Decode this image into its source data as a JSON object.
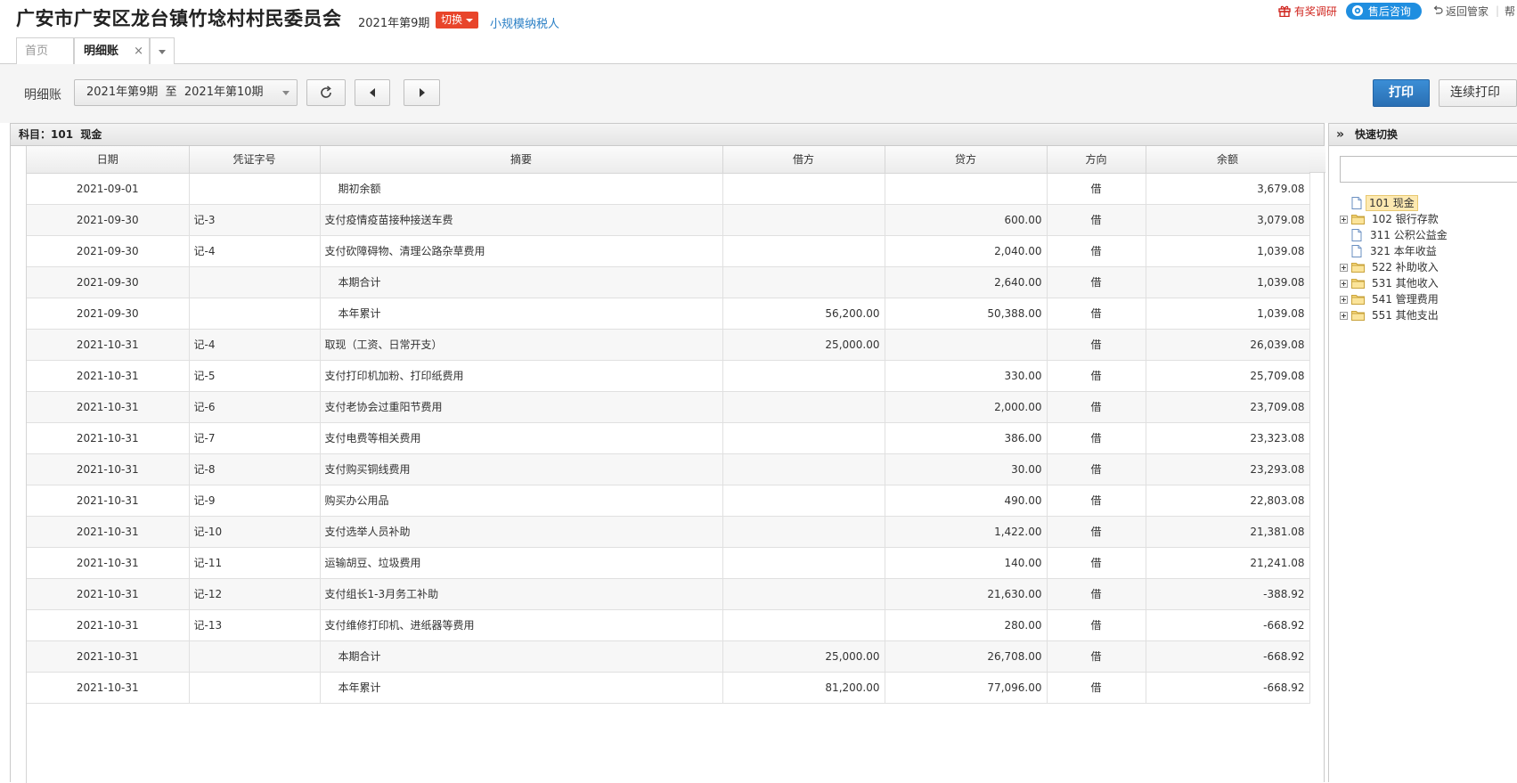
{
  "header": {
    "company": "广安市广安区龙台镇竹埝村村民委员会",
    "period": "2021年第9期",
    "switch_label": "切换",
    "taxpayer": "小规模纳税人",
    "survey": "有奖调研",
    "consult": "售后咨询",
    "back": "返回管家",
    "more": "帮"
  },
  "tabs": {
    "home": "首页",
    "detail": "明细账",
    "close": "×"
  },
  "toolbar": {
    "label": "明细账",
    "period_range": "2021年第9期  至  2021年第10期",
    "print": "打印",
    "continuous_print": "连续打印"
  },
  "panel": {
    "title": "科目：101  现金"
  },
  "table": {
    "columns": [
      "日期",
      "凭证字号",
      "摘要",
      "借方",
      "贷方",
      "方向",
      "余额"
    ],
    "rows": [
      {
        "date": "2021-09-01",
        "voucher": "",
        "summary": "期初余额",
        "indent": true,
        "debit": "",
        "credit": "",
        "dir": "借",
        "balance": "3,679.08"
      },
      {
        "date": "2021-09-30",
        "voucher": "记-3",
        "summary": "支付疫情疫苗接种接送车费",
        "indent": false,
        "debit": "",
        "credit": "600.00",
        "dir": "借",
        "balance": "3,079.08"
      },
      {
        "date": "2021-09-30",
        "voucher": "记-4",
        "summary": "支付砍障碍物、清理公路杂草费用",
        "indent": false,
        "debit": "",
        "credit": "2,040.00",
        "dir": "借",
        "balance": "1,039.08"
      },
      {
        "date": "2021-09-30",
        "voucher": "",
        "summary": "本期合计",
        "indent": true,
        "debit": "",
        "credit": "2,640.00",
        "dir": "借",
        "balance": "1,039.08"
      },
      {
        "date": "2021-09-30",
        "voucher": "",
        "summary": "本年累计",
        "indent": true,
        "debit": "56,200.00",
        "credit": "50,388.00",
        "dir": "借",
        "balance": "1,039.08"
      },
      {
        "date": "2021-10-31",
        "voucher": "记-4",
        "summary": "取现（工资、日常开支）",
        "indent": false,
        "debit": "25,000.00",
        "credit": "",
        "dir": "借",
        "balance": "26,039.08"
      },
      {
        "date": "2021-10-31",
        "voucher": "记-5",
        "summary": "支付打印机加粉、打印纸费用",
        "indent": false,
        "debit": "",
        "credit": "330.00",
        "dir": "借",
        "balance": "25,709.08"
      },
      {
        "date": "2021-10-31",
        "voucher": "记-6",
        "summary": "支付老协会过重阳节费用",
        "indent": false,
        "debit": "",
        "credit": "2,000.00",
        "dir": "借",
        "balance": "23,709.08"
      },
      {
        "date": "2021-10-31",
        "voucher": "记-7",
        "summary": "支付电费等相关费用",
        "indent": false,
        "debit": "",
        "credit": "386.00",
        "dir": "借",
        "balance": "23,323.08"
      },
      {
        "date": "2021-10-31",
        "voucher": "记-8",
        "summary": "支付购买铜线费用",
        "indent": false,
        "debit": "",
        "credit": "30.00",
        "dir": "借",
        "balance": "23,293.08"
      },
      {
        "date": "2021-10-31",
        "voucher": "记-9",
        "summary": "购买办公用品",
        "indent": false,
        "debit": "",
        "credit": "490.00",
        "dir": "借",
        "balance": "22,803.08"
      },
      {
        "date": "2021-10-31",
        "voucher": "记-10",
        "summary": "支付选举人员补助",
        "indent": false,
        "debit": "",
        "credit": "1,422.00",
        "dir": "借",
        "balance": "21,381.08"
      },
      {
        "date": "2021-10-31",
        "voucher": "记-11",
        "summary": "运输胡豆、垃圾费用",
        "indent": false,
        "debit": "",
        "credit": "140.00",
        "dir": "借",
        "balance": "21,241.08"
      },
      {
        "date": "2021-10-31",
        "voucher": "记-12",
        "summary": "支付组长1-3月务工补助",
        "indent": false,
        "debit": "",
        "credit": "21,630.00",
        "dir": "借",
        "balance": "-388.92"
      },
      {
        "date": "2021-10-31",
        "voucher": "记-13",
        "summary": "支付维修打印机、进纸器等费用",
        "indent": false,
        "debit": "",
        "credit": "280.00",
        "dir": "借",
        "balance": "-668.92"
      },
      {
        "date": "2021-10-31",
        "voucher": "",
        "summary": "本期合计",
        "indent": true,
        "debit": "25,000.00",
        "credit": "26,708.00",
        "dir": "借",
        "balance": "-668.92"
      },
      {
        "date": "2021-10-31",
        "voucher": "",
        "summary": "本年累计",
        "indent": true,
        "debit": "81,200.00",
        "credit": "77,096.00",
        "dir": "借",
        "balance": "-668.92"
      }
    ]
  },
  "side": {
    "title": "快速切换",
    "tree": [
      {
        "label": "101 现金",
        "type": "file",
        "expandable": false,
        "selected": true
      },
      {
        "label": "102 银行存款",
        "type": "folder",
        "expandable": true,
        "selected": false
      },
      {
        "label": "311 公积公益金",
        "type": "file",
        "expandable": false,
        "selected": false
      },
      {
        "label": "321 本年收益",
        "type": "file",
        "expandable": false,
        "selected": false
      },
      {
        "label": "522 补助收入",
        "type": "folder",
        "expandable": true,
        "selected": false
      },
      {
        "label": "531 其他收入",
        "type": "folder",
        "expandable": true,
        "selected": false
      },
      {
        "label": "541 管理费用",
        "type": "folder",
        "expandable": true,
        "selected": false
      },
      {
        "label": "551 其他支出",
        "type": "folder",
        "expandable": true,
        "selected": false
      }
    ]
  },
  "colors": {
    "accent_red": "#e8452b",
    "link_blue": "#2a7fc5",
    "print_blue": "#2a6fb3",
    "consult_blue": "#1f8ee0"
  }
}
